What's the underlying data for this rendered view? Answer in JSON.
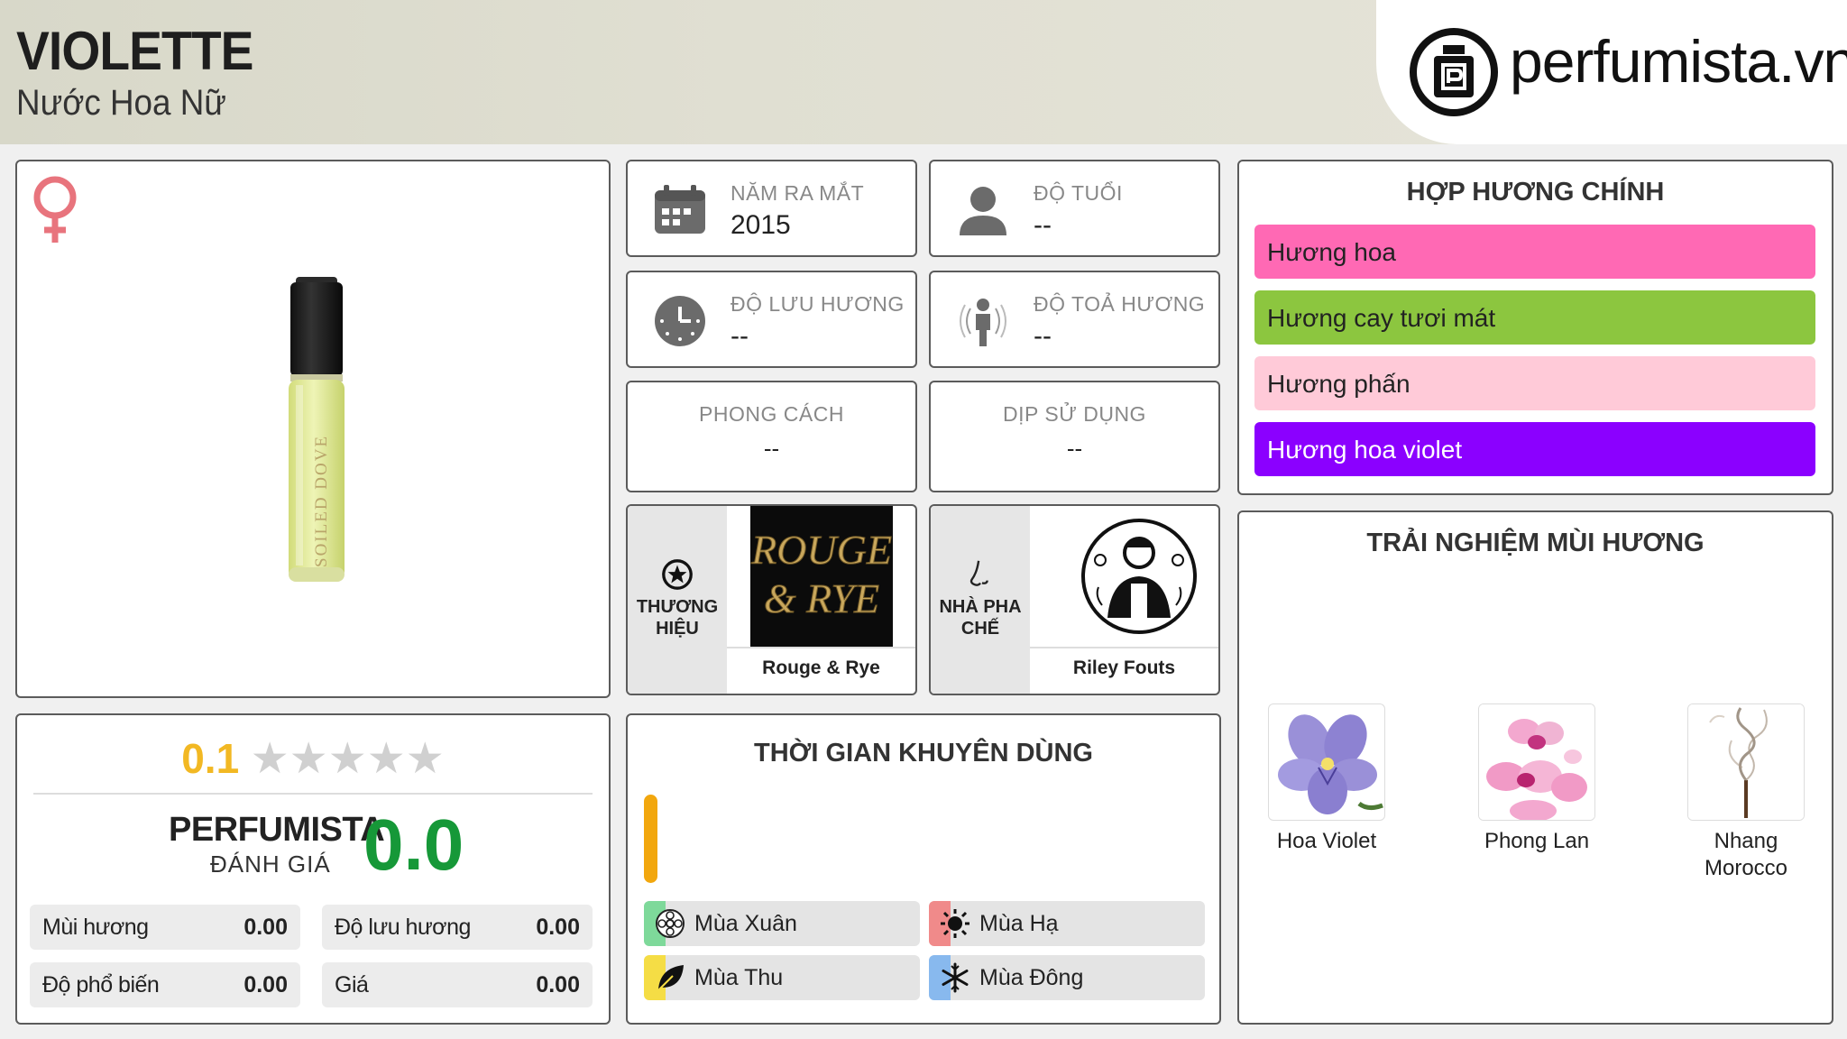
{
  "header": {
    "title": "VIOLETTE",
    "subtitle": "Nước Hoa Nữ",
    "logo_text": "perfumista.vn"
  },
  "product": {
    "gender_icon": "female-symbol-icon",
    "bottle_label": "SOILED DOVE"
  },
  "rating": {
    "user_score": "0.1",
    "stars_filled": 0,
    "stars_total": 5,
    "perfumista_label": "PERFUMISTA",
    "perfumista_sub": "ĐÁNH GIÁ",
    "perfumista_score": "0.0",
    "scores": [
      {
        "label": "Mùi hương",
        "value": "0.00"
      },
      {
        "label": "Độ lưu hương",
        "value": "0.00"
      },
      {
        "label": "Độ phổ biến",
        "value": "0.00"
      },
      {
        "label": "Giá",
        "value": "0.00"
      }
    ]
  },
  "info": {
    "release": {
      "label": "NĂM RA MẮT",
      "value": "2015",
      "icon": "calendar-icon"
    },
    "age": {
      "label": "ĐỘ TUỔI",
      "value": "--",
      "icon": "user-icon"
    },
    "longevity": {
      "label": "ĐỘ LƯU HƯƠNG",
      "value": "--",
      "icon": "clock-icon"
    },
    "sillage": {
      "label": "ĐỘ TOẢ HƯƠNG",
      "value": "--",
      "icon": "person-radiate-icon"
    },
    "style": {
      "label": "PHONG CÁCH",
      "value": "--"
    },
    "occasion": {
      "label": "DỊP SỬ DỤNG",
      "value": "--"
    }
  },
  "brand": {
    "label_line1": "THƯƠNG",
    "label_line2": "HIỆU",
    "name": "Rouge & Rye",
    "logo_text_1": "ROUGE",
    "logo_text_2": "& RYE",
    "icon": "star-circle-icon"
  },
  "perfumer": {
    "label_line1": "NHÀ PHA",
    "label_line2": "CHẾ",
    "name": "Riley Fouts",
    "icon": "nose-icon"
  },
  "seasons": {
    "title": "THỜI GIAN KHUYÊN DÙNG",
    "items": [
      {
        "label": "Mùa Xuân",
        "color": "#7ed99a",
        "icon": "flower-icon"
      },
      {
        "label": "Mùa Hạ",
        "color": "#f08a8a",
        "icon": "sun-icon"
      },
      {
        "label": "Mùa Thu",
        "color": "#f5dd45",
        "icon": "leaf-icon"
      },
      {
        "label": "Mùa Đông",
        "color": "#88b9ee",
        "icon": "snowflake-icon"
      }
    ]
  },
  "accords": {
    "title": "HỢP HƯƠNG CHÍNH",
    "items": [
      {
        "label": "Hương hoa",
        "color": "#ff69b4",
        "text_color": "#222222"
      },
      {
        "label": "Hương cay tươi mát",
        "color": "#8cc63f",
        "text_color": "#222222"
      },
      {
        "label": "Hương phấn",
        "color": "#ffcad8",
        "text_color": "#222222"
      },
      {
        "label": "Hương hoa violet",
        "color": "#8b00ff",
        "text_color": "#ffffff"
      }
    ]
  },
  "notes": {
    "title": "TRẢI NGHIỆM MÙI HƯƠNG",
    "items": [
      {
        "line1": "Hoa Violet",
        "line2": ""
      },
      {
        "line1": "Phong Lan",
        "line2": ""
      },
      {
        "line1": "Nhang",
        "line2": "Morocco"
      }
    ]
  }
}
